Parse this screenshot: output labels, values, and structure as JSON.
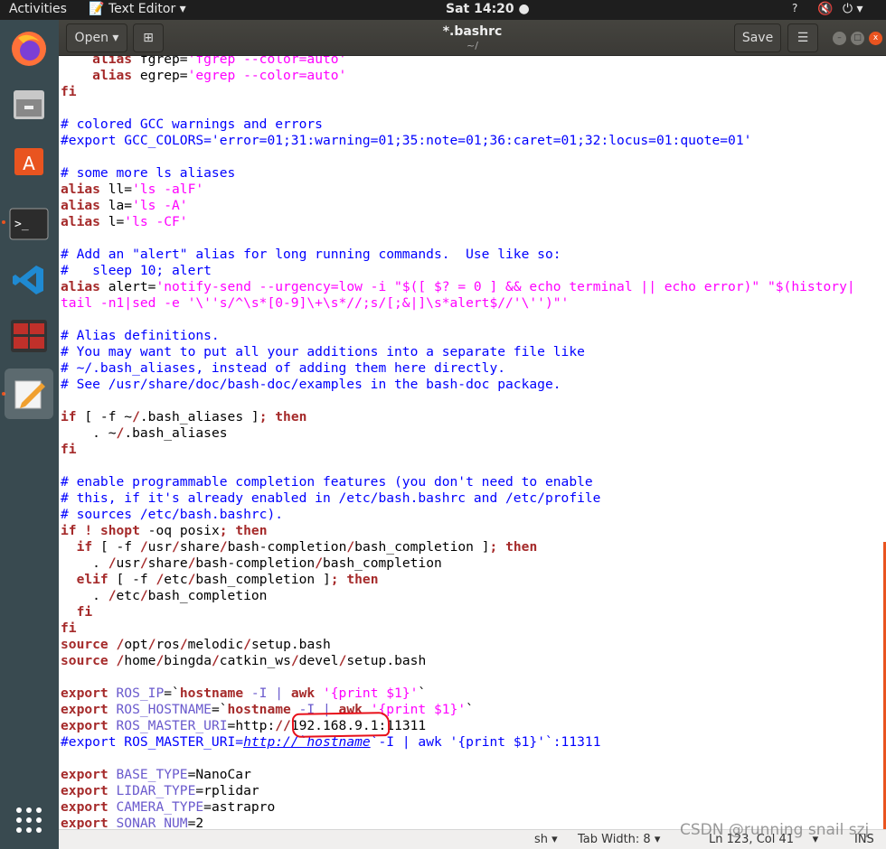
{
  "topbar": {
    "activities": "Activities",
    "app_name": "Text Editor",
    "clock": "Sat 14:20"
  },
  "launcher": {
    "apps": [
      "firefox-icon",
      "files-icon",
      "software-center-icon",
      "terminal-icon",
      "vscode-icon",
      "system-monitor-icon",
      "text-editor-icon"
    ],
    "show_apps": "apps-grid-icon"
  },
  "header": {
    "open_label": "Open",
    "title": "*.bashrc",
    "subtitle": "~/",
    "save_label": "Save"
  },
  "colors": {
    "keyword": "#a52a2a",
    "string": "#ff00ff",
    "comment": "#0000ff",
    "variable": "#6a5acd",
    "annotation": "#e8101a"
  },
  "code": [
    [
      [
        "p",
        "    "
      ],
      [
        "k",
        "alias"
      ],
      [
        "p",
        " fgrep="
      ],
      [
        "s",
        "'fgrep --color=auto'"
      ]
    ],
    [
      [
        "p",
        "    "
      ],
      [
        "k",
        "alias"
      ],
      [
        "p",
        " egrep="
      ],
      [
        "s",
        "'egrep --color=auto'"
      ]
    ],
    [
      [
        "k",
        "fi"
      ]
    ],
    [],
    [
      [
        "c",
        "# colored GCC warnings and errors"
      ]
    ],
    [
      [
        "c",
        "#export GCC_COLORS='error=01;31:warning=01;35:note=01;36:caret=01;32:locus=01:quote=01'"
      ]
    ],
    [],
    [
      [
        "c",
        "# some more ls aliases"
      ]
    ],
    [
      [
        "k",
        "alias"
      ],
      [
        "p",
        " ll="
      ],
      [
        "s",
        "'ls -alF'"
      ]
    ],
    [
      [
        "k",
        "alias"
      ],
      [
        "p",
        " la="
      ],
      [
        "s",
        "'ls -A'"
      ]
    ],
    [
      [
        "k",
        "alias"
      ],
      [
        "p",
        " l="
      ],
      [
        "s",
        "'ls -CF'"
      ]
    ],
    [],
    [
      [
        "c",
        "# Add an \"alert\" alias for long running commands.  Use like so:"
      ]
    ],
    [
      [
        "c",
        "#   sleep 10; alert"
      ]
    ],
    [
      [
        "k",
        "alias"
      ],
      [
        "p",
        " alert="
      ],
      [
        "s",
        "'notify-send --urgency=low -i \"$([ $? = 0 ] && echo terminal || echo error)\" \"$(history|"
      ]
    ],
    [
      [
        "s",
        "tail -n1|sed -e '\\''s/^\\s*[0-9]\\+\\s*//;s/[;&|]\\s*alert$//'\\'')\"'"
      ]
    ],
    [],
    [
      [
        "c",
        "# Alias definitions."
      ]
    ],
    [
      [
        "c",
        "# You may want to put all your additions into a separate file like"
      ]
    ],
    [
      [
        "c",
        "# ~/.bash_aliases, instead of adding them here directly."
      ]
    ],
    [
      [
        "c",
        "# See /usr/share/doc/bash-doc/examples in the bash-doc package."
      ]
    ],
    [],
    [
      [
        "k",
        "if"
      ],
      [
        "p",
        " [ -f ~"
      ],
      [
        "k",
        "/"
      ],
      [
        "p",
        ".bash_aliases ]"
      ],
      [
        "k",
        "; then"
      ]
    ],
    [
      [
        "p",
        "    . ~"
      ],
      [
        "k",
        "/"
      ],
      [
        "p",
        ".bash_aliases"
      ]
    ],
    [
      [
        "k",
        "fi"
      ]
    ],
    [],
    [
      [
        "c",
        "# enable programmable completion features (you don't need to enable"
      ]
    ],
    [
      [
        "c",
        "# this, if it's already enabled in /etc/bash.bashrc and /etc/profile"
      ]
    ],
    [
      [
        "c",
        "# sources /etc/bash.bashrc)."
      ]
    ],
    [
      [
        "k",
        "if !"
      ],
      [
        "p",
        " "
      ],
      [
        "k",
        "shopt"
      ],
      [
        "p",
        " -oq posix"
      ],
      [
        "k",
        "; then"
      ]
    ],
    [
      [
        "p",
        "  "
      ],
      [
        "k",
        "if"
      ],
      [
        "p",
        " [ -f "
      ],
      [
        "k",
        "/"
      ],
      [
        "p",
        "usr"
      ],
      [
        "k",
        "/"
      ],
      [
        "p",
        "share"
      ],
      [
        "k",
        "/"
      ],
      [
        "p",
        "bash-completion"
      ],
      [
        "k",
        "/"
      ],
      [
        "p",
        "bash_completion ]"
      ],
      [
        "k",
        "; then"
      ]
    ],
    [
      [
        "p",
        "    . "
      ],
      [
        "k",
        "/"
      ],
      [
        "p",
        "usr"
      ],
      [
        "k",
        "/"
      ],
      [
        "p",
        "share"
      ],
      [
        "k",
        "/"
      ],
      [
        "p",
        "bash-completion"
      ],
      [
        "k",
        "/"
      ],
      [
        "p",
        "bash_completion"
      ]
    ],
    [
      [
        "p",
        "  "
      ],
      [
        "k",
        "elif"
      ],
      [
        "p",
        " [ -f "
      ],
      [
        "k",
        "/"
      ],
      [
        "p",
        "etc"
      ],
      [
        "k",
        "/"
      ],
      [
        "p",
        "bash_completion ]"
      ],
      [
        "k",
        "; then"
      ]
    ],
    [
      [
        "p",
        "    . "
      ],
      [
        "k",
        "/"
      ],
      [
        "p",
        "etc"
      ],
      [
        "k",
        "/"
      ],
      [
        "p",
        "bash_completion"
      ]
    ],
    [
      [
        "p",
        "  "
      ],
      [
        "k",
        "fi"
      ]
    ],
    [
      [
        "k",
        "fi"
      ]
    ],
    [
      [
        "k",
        "source"
      ],
      [
        "p",
        " "
      ],
      [
        "k",
        "/"
      ],
      [
        "p",
        "opt"
      ],
      [
        "k",
        "/"
      ],
      [
        "p",
        "ros"
      ],
      [
        "k",
        "/"
      ],
      [
        "p",
        "melodic"
      ],
      [
        "k",
        "/"
      ],
      [
        "p",
        "setup.bash"
      ]
    ],
    [
      [
        "k",
        "source"
      ],
      [
        "p",
        " "
      ],
      [
        "k",
        "/"
      ],
      [
        "p",
        "home"
      ],
      [
        "k",
        "/"
      ],
      [
        "p",
        "bingda"
      ],
      [
        "k",
        "/"
      ],
      [
        "p",
        "catkin_ws"
      ],
      [
        "k",
        "/"
      ],
      [
        "p",
        "devel"
      ],
      [
        "k",
        "/"
      ],
      [
        "p",
        "setup.bash"
      ]
    ],
    [],
    [
      [
        "k",
        "export"
      ],
      [
        "p",
        " "
      ],
      [
        "v",
        "ROS_IP"
      ],
      [
        "p",
        "=`"
      ],
      [
        "k",
        "hostname"
      ],
      [
        "v",
        " -I | "
      ],
      [
        "k",
        "awk"
      ],
      [
        "p",
        " "
      ],
      [
        "s",
        "'{print $1}'"
      ],
      [
        "p",
        "`"
      ]
    ],
    [
      [
        "k",
        "export"
      ],
      [
        "p",
        " "
      ],
      [
        "v",
        "ROS_HOSTNAME"
      ],
      [
        "p",
        "=`"
      ],
      [
        "k",
        "hostname"
      ],
      [
        "v",
        " -I | "
      ],
      [
        "k",
        "awk"
      ],
      [
        "p",
        " "
      ],
      [
        "s",
        "'{print $1}'"
      ],
      [
        "p",
        "`"
      ]
    ],
    [
      [
        "k",
        "export"
      ],
      [
        "p",
        " "
      ],
      [
        "v",
        "ROS_MASTER_URI"
      ],
      [
        "p",
        "=http:"
      ],
      [
        "k",
        "//"
      ],
      [
        "p",
        "192.168.9.1:11311"
      ]
    ],
    [
      [
        "c",
        "#export ROS_MASTER_URI="
      ],
      [
        "u",
        "http://`hostname"
      ],
      [
        "c",
        "`-I | awk '{print $1}'`:11311"
      ]
    ],
    [],
    [
      [
        "k",
        "export"
      ],
      [
        "p",
        " "
      ],
      [
        "v",
        "BASE_TYPE"
      ],
      [
        "p",
        "=NanoCar"
      ]
    ],
    [
      [
        "k",
        "export"
      ],
      [
        "p",
        " "
      ],
      [
        "v",
        "LIDAR_TYPE"
      ],
      [
        "p",
        "=rplidar"
      ]
    ],
    [
      [
        "k",
        "export"
      ],
      [
        "p",
        " "
      ],
      [
        "v",
        "CAMERA_TYPE"
      ],
      [
        "p",
        "=astrapro"
      ]
    ],
    [
      [
        "k",
        "export"
      ],
      [
        "p",
        " "
      ],
      [
        "v",
        "SONAR_NUM"
      ],
      [
        "p",
        "=2"
      ]
    ]
  ],
  "status": {
    "language": "sh",
    "tab_width": "Tab Width: 8",
    "position": "Ln 123, Col 41",
    "mode": "INS"
  },
  "watermark": "CSDN @running snail szj"
}
